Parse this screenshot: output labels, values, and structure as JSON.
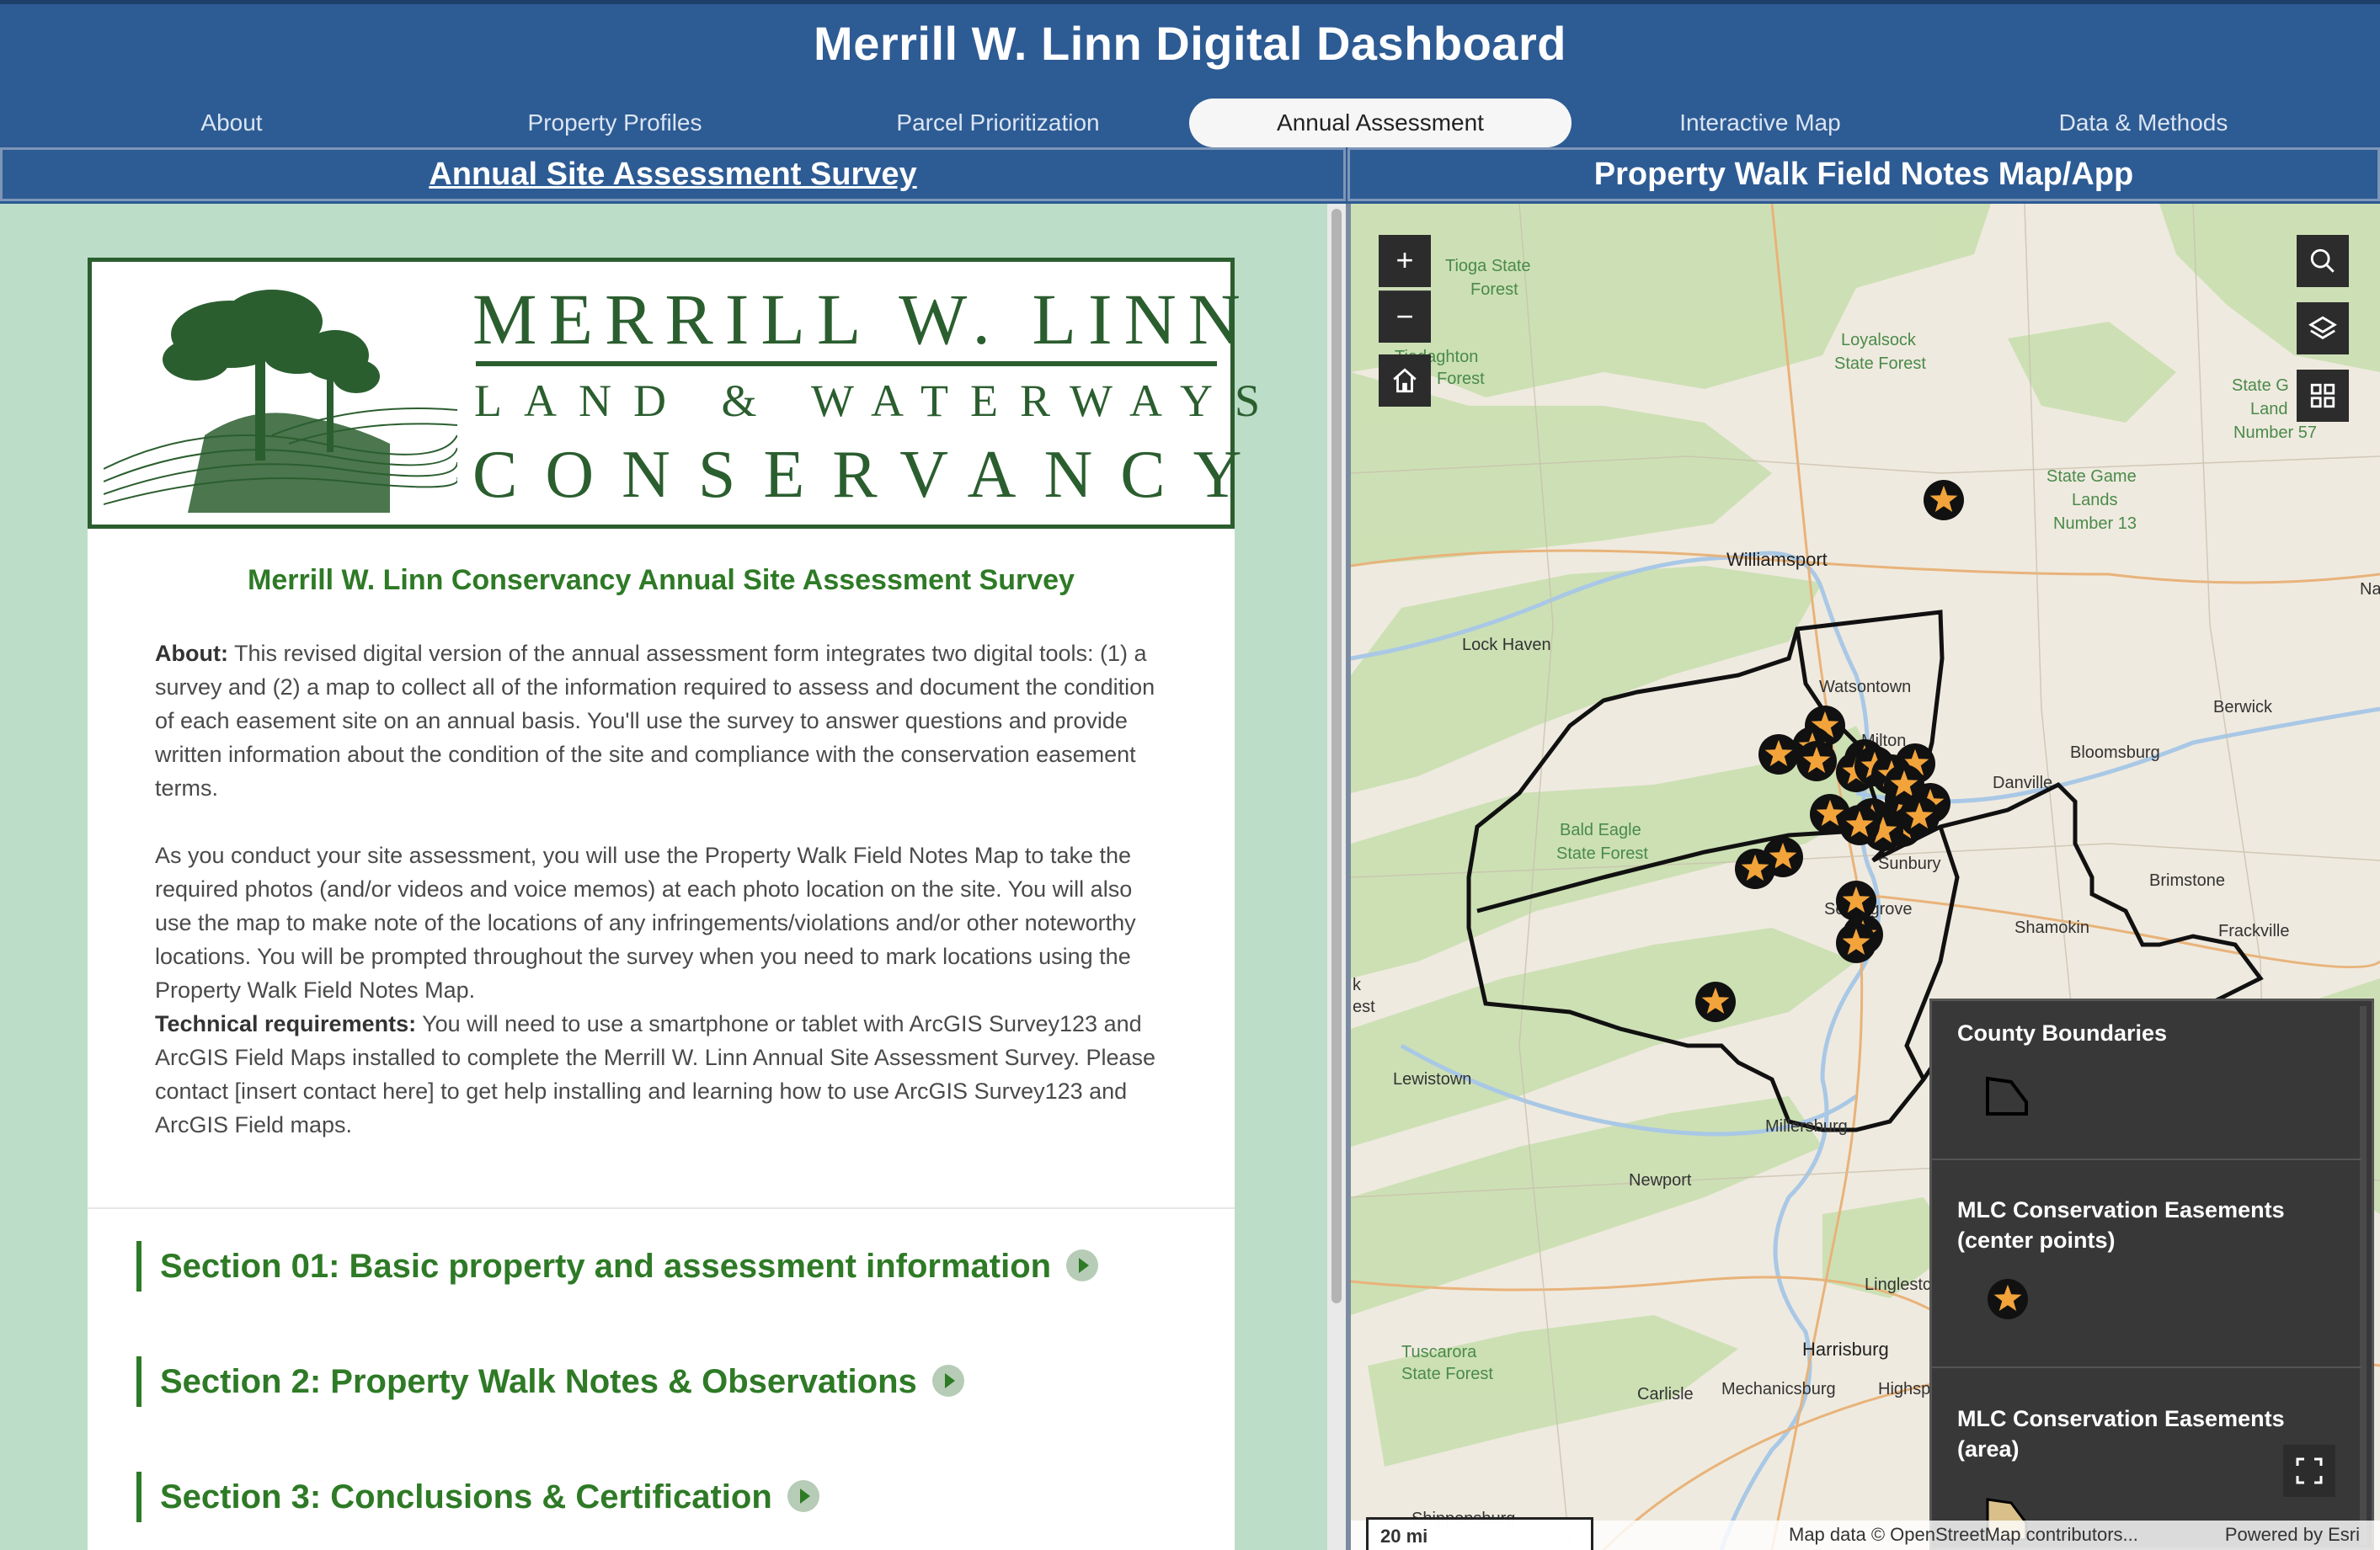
{
  "app_title": "Merrill W. Linn Digital Dashboard",
  "tabs": [
    "About",
    "Property Profiles",
    "Parcel Prioritization",
    "Annual Assessment",
    "Interactive Map",
    "Data & Methods"
  ],
  "active_tab": "Annual Assessment",
  "left_panel": {
    "heading": "Annual Site Assessment Survey",
    "logo": {
      "line1": "MERRILL W. LINN",
      "line2": "LAND & WATERWAYS",
      "line3": "CONSERVANCY"
    },
    "survey_title": "Merrill W. Linn Conservancy Annual Site Assessment Survey",
    "about_label": "About:",
    "about_text": "This revised digital version of the annual assessment form integrates two digital tools: (1) a survey and (2) a map to collect all of the information required to assess and document the condition of each easement site on an annual basis. You'll use the survey to answer questions and provide written information about the condition of the site and compliance with the conservation easement terms.",
    "para2": "As you conduct your site assessment, you will use the Property Walk Field Notes Map to take the required photos (and/or videos and voice memos) at each photo location on the site. You will also use the map to make note of the locations of any infringements/violations and/or other noteworthy locations. You will be prompted throughout the survey when you need to mark locations using the Property Walk Field Notes Map.",
    "tech_label": "Technical requirements:",
    "tech_text": "You will need to use a smartphone or tablet with ArcGIS Survey123 and ArcGIS Field Maps installed to complete the Merrill W. Linn Annual Site Assessment Survey. Please contact [insert contact here] to get help installing and learning how to use ArcGIS Survey123 and ArcGIS Field maps.",
    "sections": [
      "Section 01: Basic property and assessment information",
      "Section 2: Property Walk Notes & Observations",
      "Section 3: Conclusions & Certification"
    ]
  },
  "right_panel": {
    "heading": "Property Walk Field Notes Map/App",
    "controls": {
      "zoom_in": "+",
      "zoom_out": "−"
    },
    "places": {
      "tioga": [
        "Tioga State",
        "Forest"
      ],
      "loyalsock": [
        "Loyalsock",
        "State Forest"
      ],
      "tiadaghton": [
        "Tiadaghton",
        "Forest"
      ],
      "state_land_57": [
        "State G",
        "Land",
        "Number 57"
      ],
      "state_game_13": [
        "State Game",
        "Lands",
        "Number 13"
      ],
      "williamsport": "Williamsport",
      "lock_haven": "Lock Haven",
      "watsontown": "Watsontown",
      "milton": "Milton",
      "berwick": "Berwick",
      "bloomsburg": "Bloomsburg",
      "danville": "Danville",
      "bald_eagle": [
        "Bald Eagle",
        "State Forest"
      ],
      "sunbury": "Sunbury",
      "selinsgrove": "Selinsgrove",
      "brimstone": "Brimstone",
      "shamokin": "Shamokin",
      "frackville": "Frackville",
      "lewistown": "Lewistown",
      "millersburg": "Millersburg",
      "newport": "Newport",
      "lingleston": "Linglestc",
      "harrisburg": "Harrisburg",
      "tuscarora": [
        "Tuscarora",
        "State Forest"
      ],
      "carlisle": "Carlisle",
      "mechanicsburg": "Mechanicsburg",
      "highspire": "Highsp",
      "shippensburg": "Shippensburg",
      "na": "Na",
      "k_est": [
        "k",
        "est"
      ]
    },
    "legend": {
      "items": [
        "County Boundaries",
        "MLC Conservation Easements (center points)",
        "MLC Conservation Easements (area)"
      ],
      "colors": {
        "star": "#f2a33a",
        "point": "#111111",
        "area": "#d9bf8a"
      }
    },
    "scale_label": "20 mi",
    "attribution": "Map data © OpenStreetMap contributors...",
    "powered_by": "Powered by Esri"
  }
}
